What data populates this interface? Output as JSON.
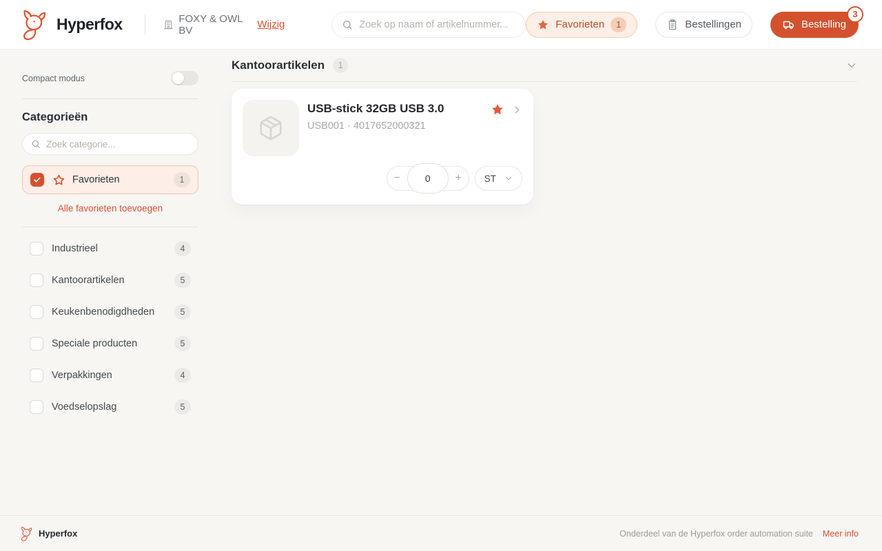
{
  "header": {
    "brand": "Hyperfox",
    "company_name": "FOXY & OWL BV",
    "change_link": "Wijzig",
    "search_placeholder": "Zoek op naam of artikelnummer...",
    "favorites_label": "Favorieten",
    "favorites_count": "1",
    "orders_label": "Bestellingen",
    "cart_label": "Bestelling",
    "cart_count": "3"
  },
  "sidebar": {
    "compact_label": "Compact modus",
    "categories_title": "Categorieën",
    "search_placeholder": "Zoek categorie...",
    "favorites_label": "Favorieten",
    "favorites_count": "1",
    "add_all_link": "Alle favorieten toevoegen",
    "categories": [
      {
        "label": "Industrieel",
        "count": "4"
      },
      {
        "label": "Kantoorartikelen",
        "count": "5"
      },
      {
        "label": "Keukenbenodigdheden",
        "count": "5"
      },
      {
        "label": "Speciale producten",
        "count": "5"
      },
      {
        "label": "Verpakkingen",
        "count": "4"
      },
      {
        "label": "Voedselopslag",
        "count": "5"
      }
    ]
  },
  "main": {
    "section_title": "Kantoorartikelen",
    "section_count": "1",
    "product": {
      "name": "USB-stick 32GB USB 3.0",
      "code": "USB001 · 4017652000321",
      "quantity": "0",
      "unit": "ST",
      "minus_label": "−",
      "plus_label": "+"
    }
  },
  "footer": {
    "brand": "Hyperfox",
    "tagline": "Onderdeel van de Hyperfox order automation suite",
    "more_info_link": "Meer info"
  },
  "colors": {
    "accent": "#d4512e",
    "accent_light_bg": "#fdeee6",
    "accent_border": "#f5c9b2",
    "page_bg": "#f7f6f3",
    "badge_bg": "#eceae6"
  }
}
